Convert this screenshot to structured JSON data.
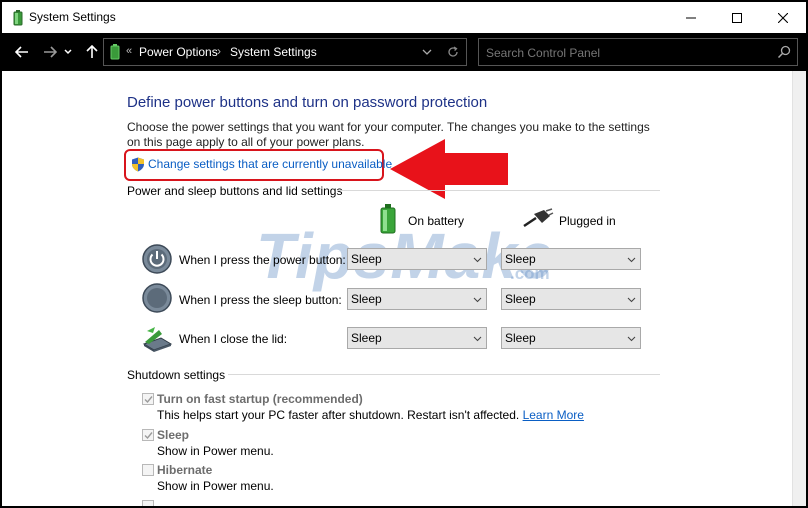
{
  "window": {
    "title": "System Settings"
  },
  "nav": {
    "breadcrumb_prefix": "«",
    "breadcrumb": [
      "Power Options",
      "System Settings"
    ],
    "search_placeholder": "Search Control Panel"
  },
  "main": {
    "heading": "Define power buttons and turn on password protection",
    "description": "Choose the power settings that you want for your computer. The changes you make to the settings on this page apply to all of your power plans.",
    "change_link": "Change settings that are currently unavailable",
    "power_group_title": "Power and sleep buttons and lid settings",
    "columns": {
      "on_battery": "On battery",
      "plugged_in": "Plugged in"
    },
    "rows": [
      {
        "label": "When I press the power button:",
        "on_battery": "Sleep",
        "plugged_in": "Sleep",
        "icon": "power-button-icon"
      },
      {
        "label": "When I press the sleep button:",
        "on_battery": "Sleep",
        "plugged_in": "Sleep",
        "icon": "sleep-button-icon"
      },
      {
        "label": "When I close the lid:",
        "on_battery": "Sleep",
        "plugged_in": "Sleep",
        "icon": "laptop-lid-icon"
      }
    ],
    "shutdown_group_title": "Shutdown settings",
    "shutdown_options": [
      {
        "label": "Turn on fast startup (recommended)",
        "checked": true,
        "description": "This helps start your PC faster after shutdown. Restart isn't affected.",
        "link": "Learn More"
      },
      {
        "label": "Sleep",
        "checked": true,
        "description": "Show in Power menu."
      },
      {
        "label": "Hibernate",
        "checked": false,
        "description": "Show in Power menu."
      }
    ]
  },
  "watermark": {
    "text": "TipsMake",
    "suffix": ".com"
  },
  "colors": {
    "heading": "#1e3287",
    "link": "#0a5ec4",
    "highlight": "#d8141c",
    "navbar": "#000000"
  }
}
